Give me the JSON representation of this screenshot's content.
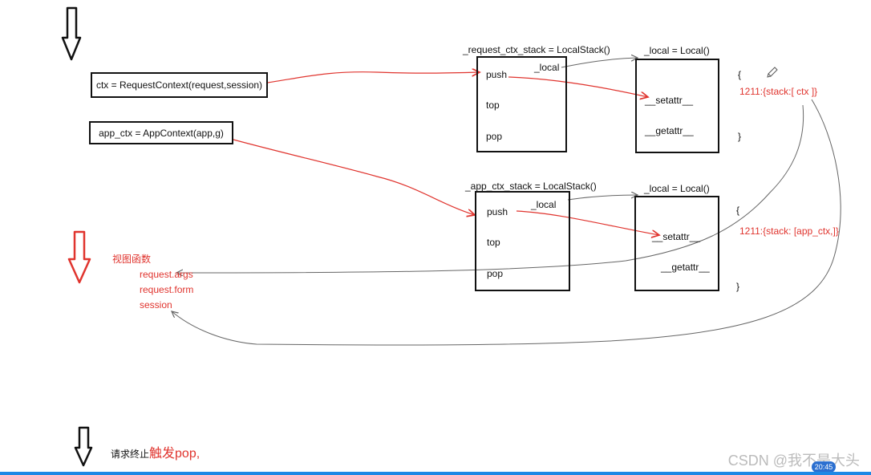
{
  "left": {
    "ctx_label": "ctx = RequestContext(request,session)",
    "app_ctx_label": "app_ctx = AppContext(app,g)",
    "view_title": "视图函数",
    "view_items": [
      "request.args",
      "request.form",
      "session"
    ],
    "end_note_small": "请求终止",
    "end_note_big": "触发pop,"
  },
  "request_stack": {
    "title": "_request_ctx_stack = LocalStack()",
    "local_label": "_local",
    "methods": [
      "push",
      "top",
      "pop"
    ]
  },
  "request_local": {
    "title": "_local = Local()",
    "methods": [
      "__setattr__",
      "__getattr__"
    ]
  },
  "request_dict": {
    "open": "{",
    "entry": "1211:{stack:[ ctx ]}",
    "close": "}"
  },
  "app_stack": {
    "title": "_app_ctx_stack = LocalStack()",
    "local_label": "_local",
    "methods": [
      "push",
      "top",
      "pop"
    ]
  },
  "app_local": {
    "title": "_local = Local()",
    "methods": [
      "__setattr__",
      "__getattr__"
    ]
  },
  "app_dict": {
    "open": "{",
    "entry": "1211:{stack: [app_ctx,]}",
    "close": "}"
  },
  "footer": {
    "watermark": "CSDN @我不是大头",
    "clock": "20:45"
  },
  "colors": {
    "red": "#e0342e",
    "black": "#111111",
    "gray": "#666666",
    "blue": "#1e88e5"
  },
  "icons": [
    "down-arrow-icon",
    "pencil-icon"
  ]
}
